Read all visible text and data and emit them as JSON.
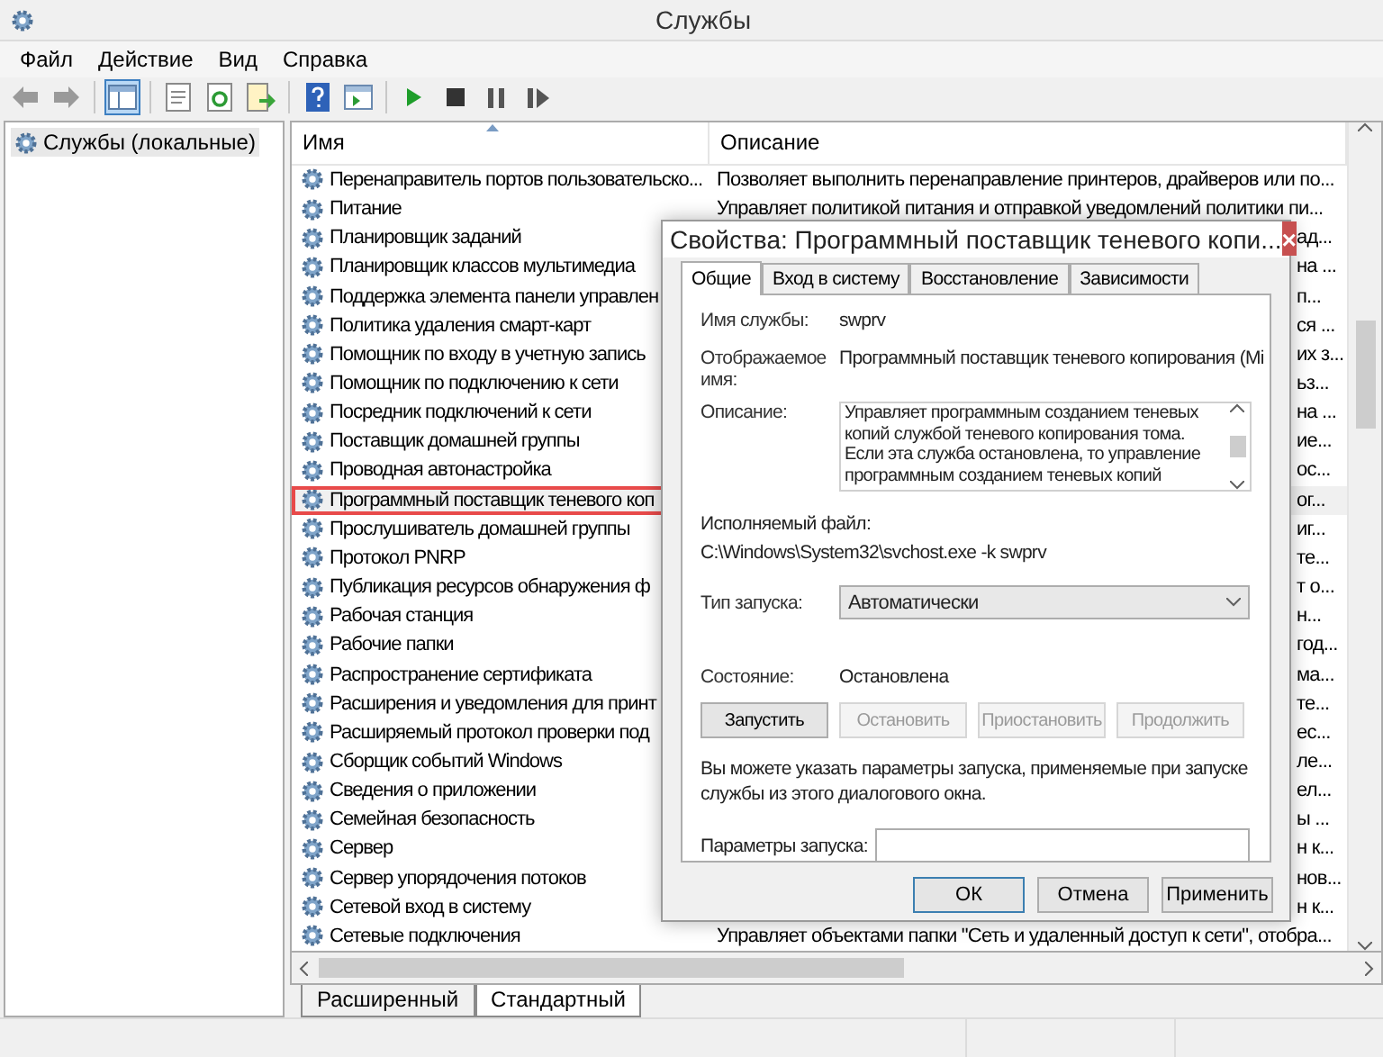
{
  "window": {
    "title": "Службы"
  },
  "menu": [
    "Файл",
    "Действие",
    "Вид",
    "Справка"
  ],
  "toolbar": [
    [
      {
        "kind": "back",
        "selected": false
      },
      {
        "kind": "forward",
        "selected": false
      }
    ],
    [
      {
        "kind": "tree",
        "selected": true
      }
    ],
    [
      {
        "kind": "properties",
        "selected": false
      },
      {
        "kind": "refresh",
        "selected": false
      },
      {
        "kind": "export",
        "selected": false
      }
    ],
    [
      {
        "kind": "help",
        "selected": false
      },
      {
        "kind": "console",
        "selected": false
      }
    ],
    [
      {
        "kind": "play",
        "selected": false
      },
      {
        "kind": "stop",
        "selected": false
      },
      {
        "kind": "pause",
        "selected": false
      },
      {
        "kind": "resume",
        "selected": false
      }
    ]
  ],
  "tree": [
    {
      "label": "Службы (локальные)",
      "selected": true
    }
  ],
  "columns": [
    {
      "label": "Имя",
      "sorted": true
    },
    {
      "label": "Описание",
      "sorted": false
    }
  ],
  "rows": [
    {
      "name": "Перенаправитель портов пользовательско...",
      "description": "Позволяет выполнить перенаправление принтеров, драйверов или по...",
      "covered": false,
      "selected": false
    },
    {
      "name": "Питание",
      "description": "Управляет политикой питания и отправкой уведомлений политики пи...",
      "covered": false,
      "selected": false
    },
    {
      "name": "Планировщик заданий",
      "description": "ад...",
      "covered": true,
      "selected": false
    },
    {
      "name": "Планировщик классов мультимедиа",
      "description": "на ...",
      "covered": true,
      "selected": false
    },
    {
      "name": "Поддержка элемента панели управлен",
      "description": "п...",
      "covered": true,
      "selected": false
    },
    {
      "name": "Политика удаления смарт-карт",
      "description": "ся ...",
      "covered": true,
      "selected": false
    },
    {
      "name": "Помощник по входу в учетную запись",
      "description": "их з...",
      "covered": true,
      "selected": false
    },
    {
      "name": "Помощник по подключению к сети",
      "description": "ьз...",
      "covered": true,
      "selected": false
    },
    {
      "name": "Посредник подключений к сети",
      "description": "на ...",
      "covered": true,
      "selected": false
    },
    {
      "name": "Поставщик домашней группы",
      "description": "ие...",
      "covered": true,
      "selected": false
    },
    {
      "name": "Проводная автонастройка",
      "description": "ос...",
      "covered": true,
      "selected": false
    },
    {
      "name": "Программный поставщик теневого коп",
      "description": "ог...",
      "covered": true,
      "selected": true
    },
    {
      "name": "Прослушиватель домашней группы",
      "description": "иг...",
      "covered": true,
      "selected": false
    },
    {
      "name": "Протокол PNRP",
      "description": "те...",
      "covered": true,
      "selected": false
    },
    {
      "name": "Публикация ресурсов обнаружения ф",
      "description": "т о...",
      "covered": true,
      "selected": false
    },
    {
      "name": "Рабочая станция",
      "description": "н...",
      "covered": true,
      "selected": false
    },
    {
      "name": "Рабочие папки",
      "description": "год...",
      "covered": true,
      "selected": false
    },
    {
      "name": "Распространение сертификата",
      "description": "ма...",
      "covered": true,
      "selected": false
    },
    {
      "name": "Расширения и уведомления для принт",
      "description": "те...",
      "covered": true,
      "selected": false
    },
    {
      "name": "Расширяемый протокол проверки под",
      "description": "ес...",
      "covered": true,
      "selected": false
    },
    {
      "name": "Сборщик событий Windows",
      "description": "ле...",
      "covered": true,
      "selected": false
    },
    {
      "name": "Сведения о приложении",
      "description": "ел...",
      "covered": true,
      "selected": false
    },
    {
      "name": "Семейная безопасность",
      "description": "ы ...",
      "covered": true,
      "selected": false
    },
    {
      "name": "Сервер",
      "description": "н к...",
      "covered": true,
      "selected": false
    },
    {
      "name": "Сервер упорядочения потоков",
      "description": "нов...",
      "covered": true,
      "selected": false
    },
    {
      "name": "Сетевой вход в систему",
      "description": "н к...",
      "covered": true,
      "selected": false
    },
    {
      "name": "Сетевые подключения",
      "description": "Управляет объектами папки \"Сеть и удаленный доступ к сети\", отобра...",
      "covered": false,
      "selected": false
    }
  ],
  "view_tabs": [
    {
      "label": "Расширенный",
      "selected": false
    },
    {
      "label": "Стандартный",
      "selected": true
    }
  ],
  "dialog": {
    "title": "Свойства: Программный поставщик теневого копи...",
    "close": "×",
    "tabs": [
      {
        "label": "Общие",
        "selected": true
      },
      {
        "label": "Вход в систему",
        "selected": false
      },
      {
        "label": "Восстановление",
        "selected": false
      },
      {
        "label": "Зависимости",
        "selected": false
      }
    ],
    "service_name_label": "Имя службы:",
    "service_name": "swprv",
    "display_name_label": "Отображаемое имя:",
    "display_name": "Программный поставщик теневого копирования (Mi",
    "description_label": "Описание:",
    "description": "Управляет программным созданием теневых копий службой теневого копирования тома. Если эта служба остановлена, то управление программным созданием теневых копий",
    "exe_label": "Исполняемый файл:",
    "exe_path": "C:\\Windows\\System32\\svchost.exe -k swprv",
    "startup_label": "Тип запуска:",
    "startup_value": "Автоматически",
    "status_label": "Состояние:",
    "status_value": "Остановлена",
    "service_buttons": [
      {
        "label": "Запустить",
        "disabled": false
      },
      {
        "label": "Остановить",
        "disabled": true
      },
      {
        "label": "Приостановить",
        "disabled": true
      },
      {
        "label": "Продолжить",
        "disabled": true
      }
    ],
    "hint": "Вы можете указать параметры запуска, применяемые при запуске службы из этого диалогового окна.",
    "params_label": "Параметры запуска:",
    "footer_buttons": [
      {
        "label": "ОК",
        "default": true
      },
      {
        "label": "Отмена",
        "default": false
      },
      {
        "label": "Применить",
        "default": false
      }
    ]
  }
}
